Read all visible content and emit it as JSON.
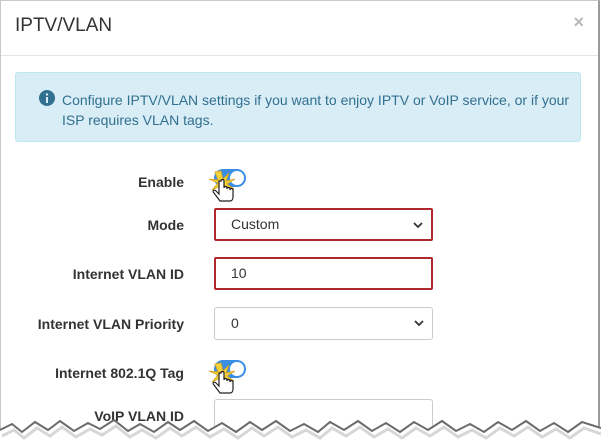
{
  "dialog": {
    "title": "IPTV/VLAN",
    "close_label": "×"
  },
  "info": {
    "text": "Configure IPTV/VLAN settings if you want to enjoy IPTV or VoIP service, or if your ISP requires VLAN tags."
  },
  "form": {
    "enable": {
      "label": "Enable",
      "checked": true
    },
    "mode": {
      "label": "Mode",
      "value": "Custom"
    },
    "internet_vlan_id": {
      "label": "Internet VLAN ID",
      "value": "10"
    },
    "internet_vlan_priority": {
      "label": "Internet VLAN Priority",
      "value": "0"
    },
    "internet_8021q_tag": {
      "label": "Internet 802.1Q Tag",
      "checked": true
    },
    "voip_vlan_id": {
      "label": "VoIP VLAN ID",
      "value": ""
    }
  },
  "colors": {
    "toggle_on": "#3a8ee6",
    "highlight_border": "#b0282d",
    "info_bg": "#d9edf7",
    "info_text": "#31708f"
  },
  "icons": [
    "info-circle-icon",
    "close-icon",
    "chevron-down-icon",
    "pointer-hand-icon"
  ]
}
